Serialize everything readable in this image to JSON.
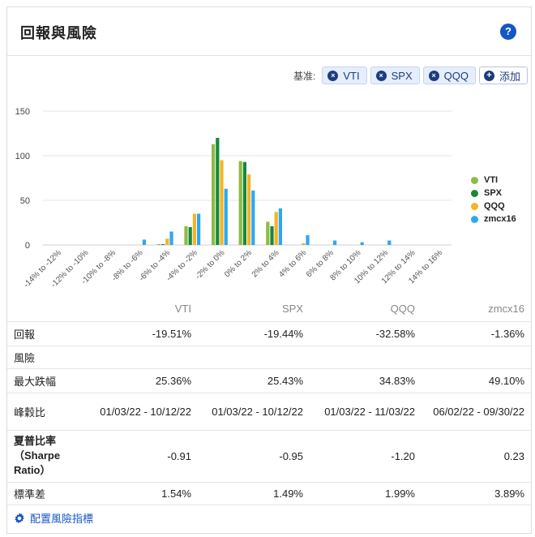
{
  "title": "回報與風險",
  "help_label": "?",
  "benchmark": {
    "label": "基准:",
    "chips": [
      "VTI",
      "SPX",
      "QQQ"
    ],
    "add_label": "添加",
    "remove_glyph": "×",
    "add_glyph": "+"
  },
  "colors": {
    "VTI": "#8dbb45",
    "SPX": "#16893a",
    "QQQ": "#f6b324",
    "zmcx16": "#2ea7f2"
  },
  "chart_data": {
    "type": "bar",
    "ylim": [
      0,
      150
    ],
    "yticks": [
      0,
      50,
      100,
      150
    ],
    "grid": true,
    "legend_position": "right",
    "categories": [
      "-14% to -12%",
      "-12% to -10%",
      "-10% to -8%",
      "-8% to -6%",
      "-6% to -4%",
      "-4% to -2%",
      "-2% to 0%",
      "0% to 2%",
      "2% to 4%",
      "4% to 6%",
      "6% to 8%",
      "8% to 10%",
      "10% to 12%",
      "12% to 14%",
      "14% to 16%"
    ],
    "series": [
      {
        "name": "VTI",
        "values": [
          0,
          0,
          0,
          0,
          1,
          21,
          113,
          94,
          26,
          0,
          0,
          0,
          0,
          0,
          0
        ]
      },
      {
        "name": "SPX",
        "values": [
          0,
          0,
          0,
          0,
          1,
          20,
          120,
          93,
          21,
          0,
          0,
          0,
          0,
          0,
          0
        ]
      },
      {
        "name": "QQQ",
        "values": [
          0,
          0,
          0,
          0,
          7,
          35,
          95,
          79,
          37,
          2,
          0,
          0,
          0,
          0,
          0
        ]
      },
      {
        "name": "zmcx16",
        "values": [
          0,
          0,
          0,
          6,
          15,
          35,
          63,
          61,
          41,
          11,
          5,
          3,
          5,
          0,
          0
        ]
      }
    ]
  },
  "table": {
    "columns": [
      "VTI",
      "SPX",
      "QQQ",
      "zmcx16"
    ],
    "rows": [
      {
        "label": "回報",
        "values": [
          "-19.51%",
          "-19.44%",
          "-32.58%",
          "-1.36%"
        ]
      },
      {
        "label": "風險",
        "values": [
          "",
          "",
          "",
          ""
        ]
      },
      {
        "label": "最大跌幅",
        "values": [
          "25.36%",
          "25.43%",
          "34.83%",
          "49.10%"
        ]
      },
      {
        "label": "峰穀比",
        "values": [
          "01/03/22 - 10/12/22",
          "01/03/22 - 10/12/22",
          "01/03/22 - 11/03/22",
          "06/02/22 - 09/30/22"
        ]
      },
      {
        "label": "夏普比率（Sharpe Ratio）",
        "values": [
          "-0.91",
          "-0.95",
          "-1.20",
          "0.23"
        ]
      },
      {
        "label": "標準差",
        "values": [
          "1.54%",
          "1.49%",
          "1.99%",
          "3.89%"
        ]
      }
    ]
  },
  "config_link": "配置風險指標"
}
